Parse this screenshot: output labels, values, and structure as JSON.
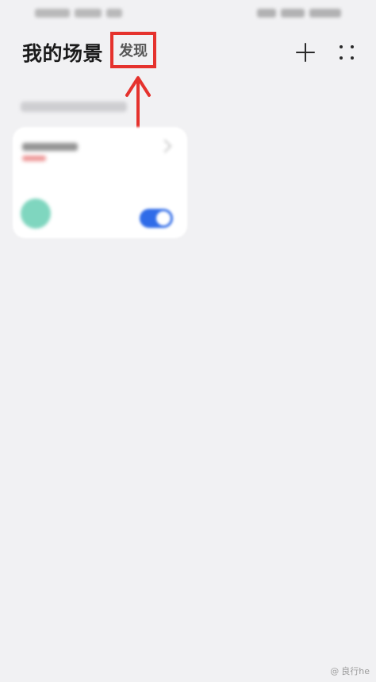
{
  "header": {
    "title": "我的场景",
    "discover_tab": "发现"
  },
  "icons": {
    "add": "plus-icon",
    "more": "grid-dots-icon",
    "annotation": "red-up-arrow"
  },
  "scene_card": {
    "toggle_on": true,
    "avatar_color": "#7fd6bf",
    "toggle_color": "#2f6be8"
  },
  "annotation": {
    "highlight_color": "#e5322d"
  },
  "watermark": {
    "symbol": "@",
    "text": "良行he"
  }
}
